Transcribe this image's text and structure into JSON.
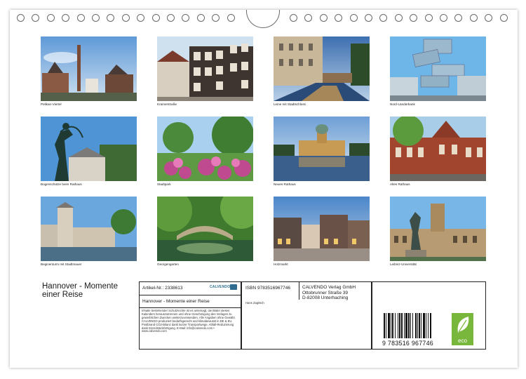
{
  "photos": [
    {
      "caption": "Pelikan-Viertel"
    },
    {
      "caption": "Kramerstraße"
    },
    {
      "caption": "Leine mit Stadtschloss"
    },
    {
      "caption": "Nord-Länderbank"
    },
    {
      "caption": "Bogenschütze beim Rathaus"
    },
    {
      "caption": "Stadtpark"
    },
    {
      "caption": "Neues Rathaus"
    },
    {
      "caption": "Altes Rathaus"
    },
    {
      "caption": "Beginenturm mit Stadtmauer"
    },
    {
      "caption": "Georgengarten"
    },
    {
      "caption": "Holzmarkt"
    },
    {
      "caption": "Leibniz-Universität"
    }
  ],
  "calendar": {
    "title": "Hannover - Momente einer Reise"
  },
  "info": {
    "article": "Artikel-Nr.: 2338613",
    "brand": "CALVENDO",
    "title": "Hannover - Momente einer Reise",
    "isbn": "ISBN 9783516967746",
    "author": "Hans Zagitsch",
    "publisher": [
      "CALVENDO Verlag GmbH",
      "Ottobrunner Straße 39",
      "D-82008 Unterhaching"
    ],
    "legal": "Inhalte bestehender Schutzrechte ist es untersagt, die Bilder dieses Kalenders herauszutrennen und ohne Genehmigung des Verlages zu gewerblichen Zwecken weiterzuverwenden. Alle Angaben ohne Gewähr. CALVENDO produziert bedarfsgerecht und klimabewusst in DE & EU. Postbrand CO2-Bilanz dank kurzer Transportwege. Abfall-Reduzierung dank Einzelstückfertigung. E-Mail: info@calvendo.com • www.calvendo.com",
    "barcode": "9 783516 967746",
    "eco_label": "eco"
  },
  "colors": {
    "sky": "#7fb2e0",
    "eco_green": "#79b63c",
    "brand_blue": "#2f6c8f"
  }
}
